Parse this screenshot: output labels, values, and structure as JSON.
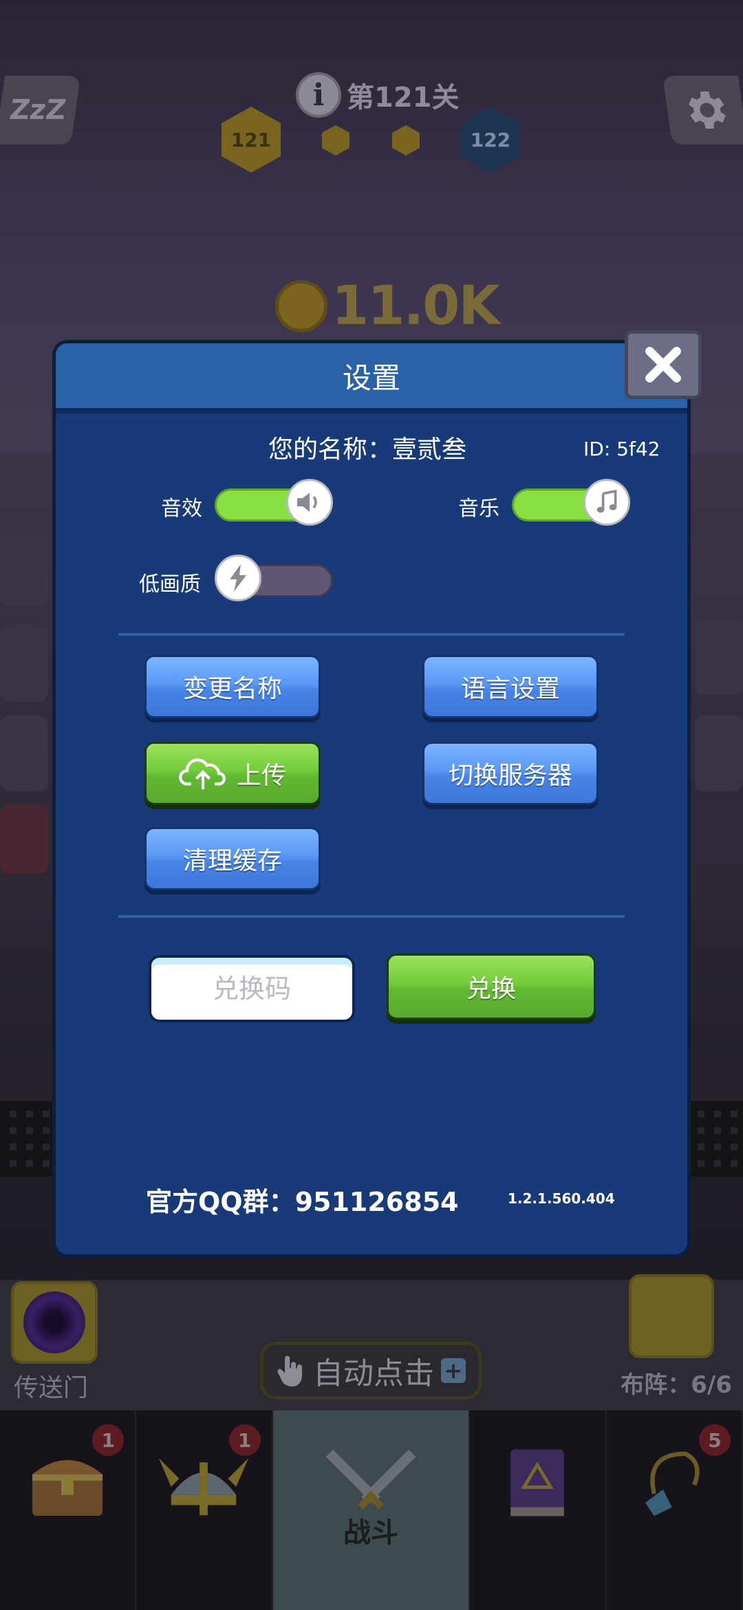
{
  "hud": {
    "sleep_label": "ZzZ",
    "level_title": "第121关",
    "current_level": "121",
    "next_level": "122",
    "coins": "11.0K",
    "portal_label": "传送门",
    "auto_click_label": "自动点击",
    "team_label": "布阵：6/6"
  },
  "dialog": {
    "title": "设置",
    "name_line": "您的名称：壹贰叁",
    "id_line": "ID:  5f42",
    "sound_label": "音效",
    "music_label": "音乐",
    "low_quality_label": "低画质",
    "sound_on": true,
    "music_on": true,
    "low_quality_on": false,
    "buttons": {
      "rename": "变更名称",
      "language": "语言设置",
      "upload": "上传",
      "switch_server": "切换服务器",
      "clear_cache": "清理缓存",
      "redeem": "兑换"
    },
    "code_placeholder": "兑换码",
    "qq_group": "官方QQ群：951126854",
    "version": "1.2.1.560.404"
  },
  "nav": {
    "chest_badge": "1",
    "hero_badge": "1",
    "battle_label": "战斗",
    "amulet_badge": "5"
  },
  "colors": {
    "dialog_bg": "#193a78",
    "header_bg": "#2962a8",
    "button_blue": "#4e8cf0",
    "button_green": "#6cc238",
    "toggle_on": "#8ae040"
  }
}
